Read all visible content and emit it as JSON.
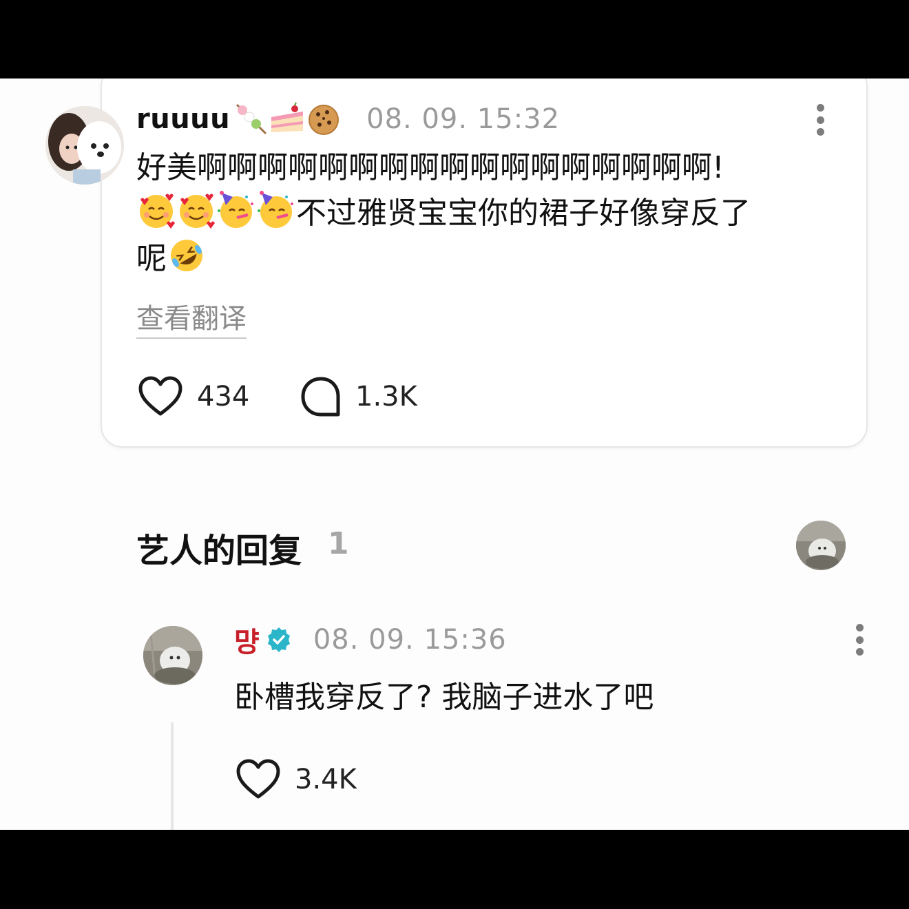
{
  "comment": {
    "username": "ruuuu",
    "username_emojis": [
      "dango-icon",
      "cake-slice-icon",
      "cookie-icon"
    ],
    "timestamp": "08. 09. 15:32",
    "text_line1": "好美啊啊啊啊啊啊啊啊啊啊啊啊啊啊啊啊啊!",
    "text_line2_after_emojis": "不过雅贤宝宝你的裙子好像穿反了",
    "text_line3": "呢",
    "inline_emojis": [
      "smiling-face-with-hearts-icon",
      "smiling-face-with-hearts-icon",
      "partying-face-icon",
      "partying-face-icon"
    ],
    "end_emoji": "rolling-on-floor-laughing-icon",
    "translate_label": "查看翻译",
    "likes": "434",
    "replies": "1.3K"
  },
  "section": {
    "title": "艺人的回复",
    "count": "1"
  },
  "reply": {
    "username": "먕",
    "timestamp": "08. 09. 15:36",
    "text": "卧槽我穿反了?  我脑子进水了吧",
    "likes": "3.4K"
  },
  "colors": {
    "artist_name": "#c8202a",
    "verified_badge": "#2bb5c9",
    "timestamp": "#9a9a9a",
    "background": "#fdfdfd"
  }
}
